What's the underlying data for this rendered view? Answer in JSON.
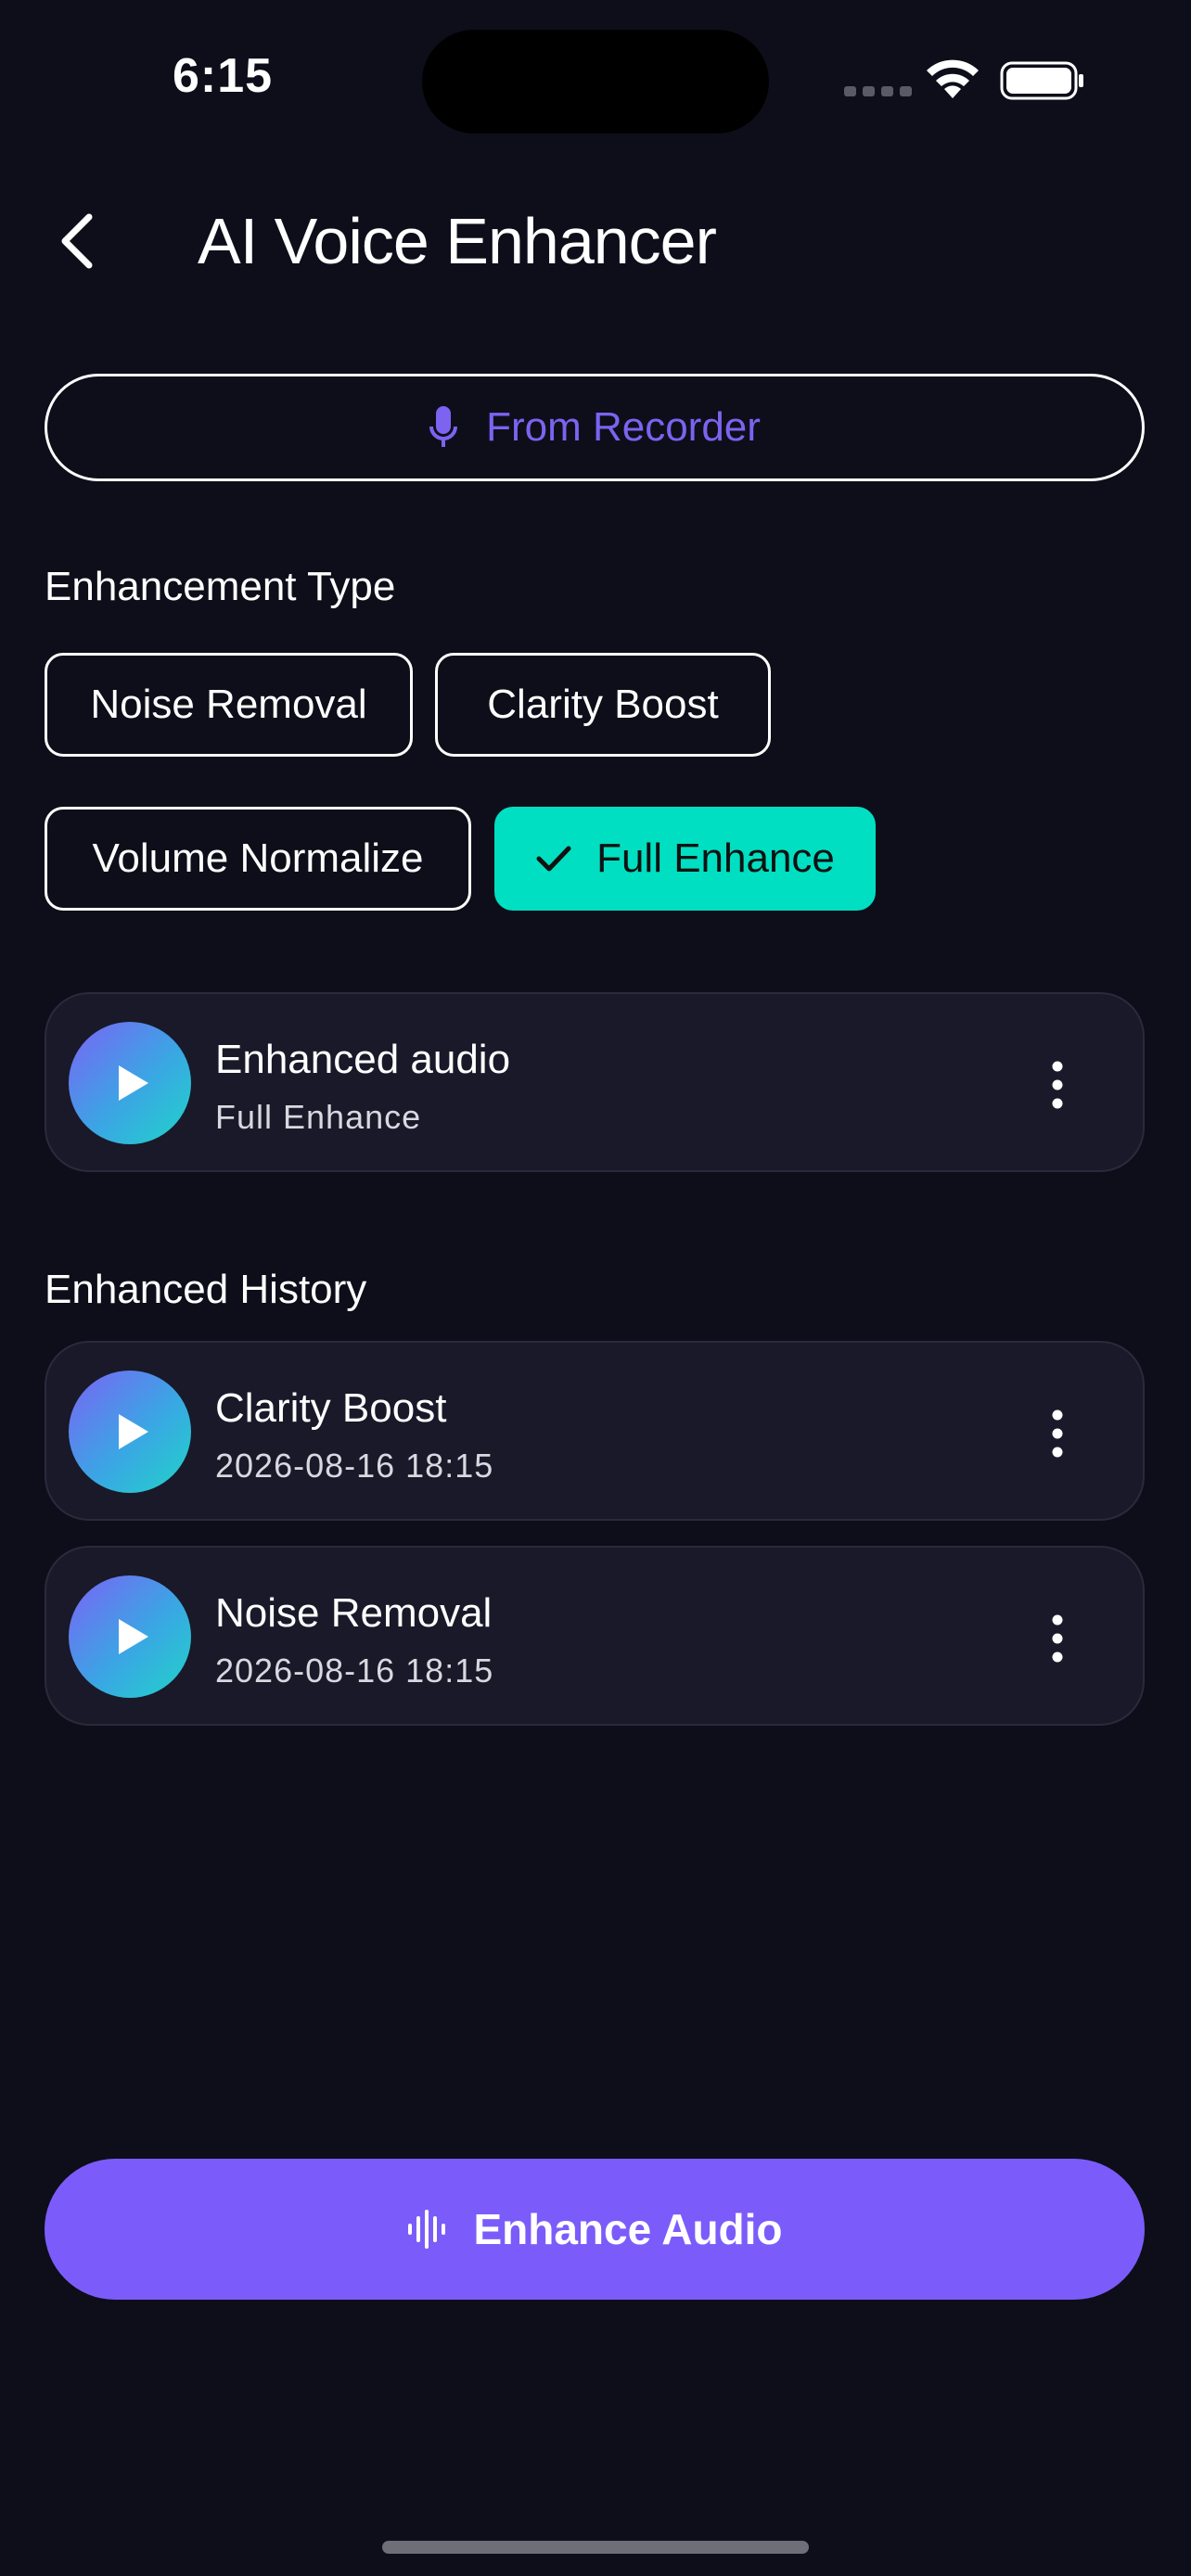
{
  "status_bar": {
    "time": "6:15"
  },
  "header": {
    "title": "AI Voice Enhancer"
  },
  "source_button": {
    "label": "From Recorder"
  },
  "enhancement": {
    "section_label": "Enhancement Type",
    "options": [
      {
        "label": "Noise Removal",
        "selected": false
      },
      {
        "label": "Clarity Boost",
        "selected": false
      },
      {
        "label": "Volume Normalize",
        "selected": false
      },
      {
        "label": "Full Enhance",
        "selected": true
      }
    ]
  },
  "current_result": {
    "title": "Enhanced audio",
    "subtitle": "Full Enhance"
  },
  "history": {
    "section_label": "Enhanced History",
    "items": [
      {
        "title": "Clarity Boost",
        "timestamp": "2026-08-16 18:15"
      },
      {
        "title": "Noise Removal",
        "timestamp": "2026-08-16 18:15"
      }
    ]
  },
  "action_button": {
    "label": "Enhance Audio"
  },
  "colors": {
    "background": "#0e0e1a",
    "accent_purple": "#7b5cfa",
    "selected_chip": "#00dfc1",
    "card_background": "#191929"
  },
  "icons": [
    "back-chevron-icon",
    "microphone-icon",
    "checkmark-icon",
    "play-icon",
    "more-vertical-icon",
    "waveform-icon",
    "wifi-icon",
    "battery-icon"
  ]
}
